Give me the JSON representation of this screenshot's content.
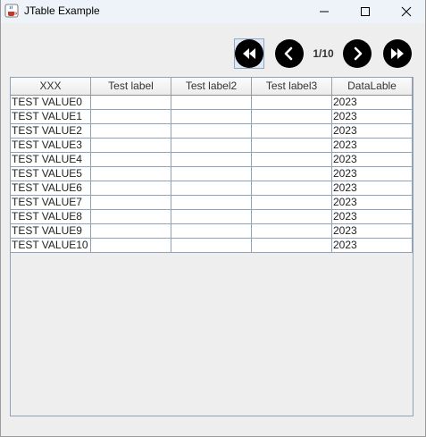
{
  "window": {
    "title": "JTable Example"
  },
  "pagination": {
    "page_indicator": "1/10"
  },
  "table": {
    "columns": [
      "XXX",
      "Test label",
      "Test label2",
      "Test label3",
      "DataLable"
    ],
    "rows": [
      [
        "TEST VALUE0",
        "",
        "",
        "",
        "2023"
      ],
      [
        "TEST VALUE1",
        "",
        "",
        "",
        "2023"
      ],
      [
        "TEST VALUE2",
        "",
        "",
        "",
        "2023"
      ],
      [
        "TEST VALUE3",
        "",
        "",
        "",
        "2023"
      ],
      [
        "TEST VALUE4",
        "",
        "",
        "",
        "2023"
      ],
      [
        "TEST VALUE5",
        "",
        "",
        "",
        "2023"
      ],
      [
        "TEST VALUE6",
        "",
        "",
        "",
        "2023"
      ],
      [
        "TEST VALUE7",
        "",
        "",
        "",
        "2023"
      ],
      [
        "TEST VALUE8",
        "",
        "",
        "",
        "2023"
      ],
      [
        "TEST VALUE9",
        "",
        "",
        "",
        "2023"
      ],
      [
        "TEST VALUE10",
        "",
        "",
        "",
        "2023"
      ]
    ]
  },
  "icons": {
    "app": "java-cup-icon",
    "minimize": "minimize-icon",
    "maximize": "maximize-icon",
    "close": "close-icon",
    "first": "double-chevron-left-icon",
    "prev": "chevron-left-icon",
    "next": "chevron-right-icon",
    "last": "double-chevron-right-icon"
  },
  "colors": {
    "window_bg": "#eeeeee",
    "titlebar_bg": "#eef3fa",
    "grid_line": "#8fa2b8",
    "nav_button": "#000000"
  }
}
